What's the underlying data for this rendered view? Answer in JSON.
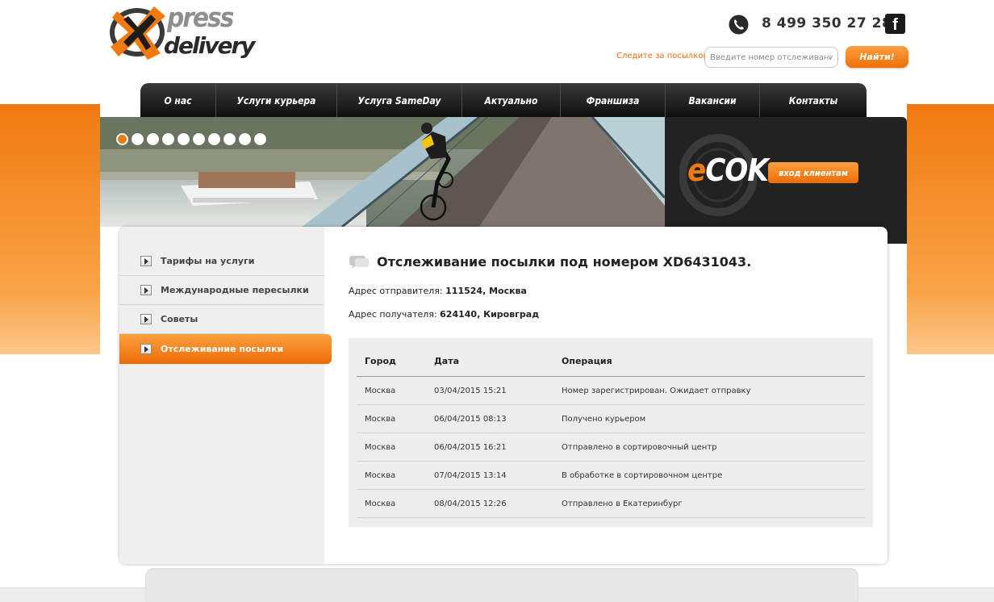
{
  "logo": {
    "word1": "press",
    "word2": "delivery"
  },
  "header": {
    "phone": "8 499 350 27 28",
    "facebook_glyph": "f",
    "track_label": "Следите за посылкой!",
    "track_placeholder": "Введите номер отслеживания",
    "track_button": "Найти!"
  },
  "nav": {
    "items": [
      {
        "label": "О нас"
      },
      {
        "label": "Услуги курьера"
      },
      {
        "label": "Услуга SameDay"
      },
      {
        "label": "Актуально"
      },
      {
        "label": "Франшиза"
      },
      {
        "label": "Вакансии"
      },
      {
        "label": "Контакты"
      }
    ]
  },
  "slider": {
    "dot_count": 10,
    "active_index": 0
  },
  "ecok": {
    "e": "e",
    "rest": "COK",
    "login_button": "вход клиентам"
  },
  "sidebar": {
    "items": [
      {
        "label": "Тарифы на услуги"
      },
      {
        "label": "Международные пересылки"
      },
      {
        "label": "Советы"
      },
      {
        "label": "Отслеживание посылки"
      }
    ],
    "active_index": 3
  },
  "main": {
    "title": "Отслеживание посылки под номером XD6431043.",
    "sender_label": "Адрес отправителя:",
    "sender_value": "111524, Москва",
    "recipient_label": "Адрес получателя:",
    "recipient_value": "624140, Кировград"
  },
  "table": {
    "headers": {
      "city": "Город",
      "date": "Дата",
      "operation": "Операция"
    },
    "rows": [
      {
        "city": "Москва",
        "date": "03/04/2015 15:21",
        "operation": "Номер зарегистрирован. Ожидает отправку"
      },
      {
        "city": "Москва",
        "date": "06/04/2015 08:13",
        "operation": "Получено курьером"
      },
      {
        "city": "Москва",
        "date": "06/04/2015 16:21",
        "operation": "Отправлено в сортировочный центр"
      },
      {
        "city": "Москва",
        "date": "07/04/2015 13:14",
        "operation": "В обработке в сортировочном центре"
      },
      {
        "city": "Москва",
        "date": "08/04/2015 12:26",
        "operation": "Отправлено в Екатеринбург"
      }
    ]
  },
  "colors": {
    "accent": "#f07a10",
    "nav_bg": "#1a1a1a",
    "panel_bg": "#222222"
  },
  "icons": {
    "phone": "phone-icon",
    "facebook": "facebook-icon",
    "arrow": "arrow-right-icon",
    "bubble": "speech-bubble-icon"
  }
}
